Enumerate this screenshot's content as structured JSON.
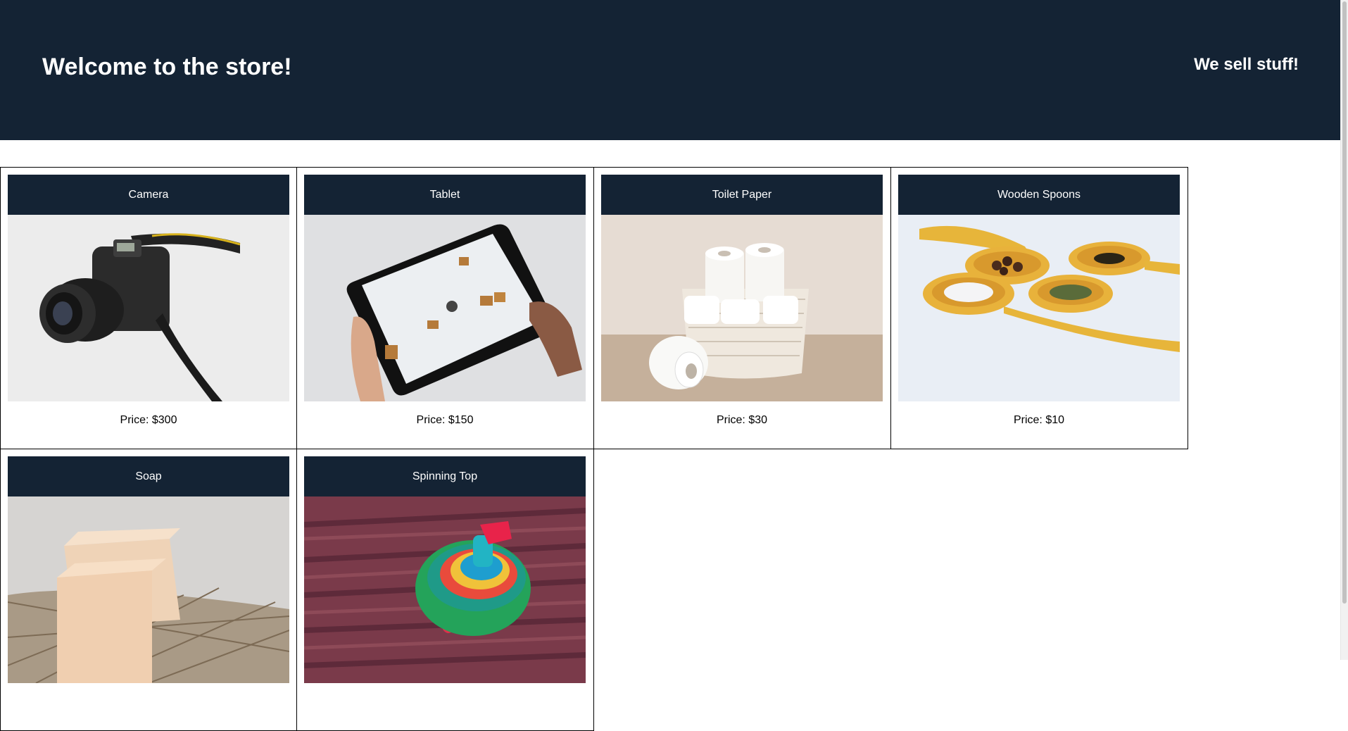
{
  "header": {
    "title": "Welcome to the store!",
    "tagline": "We sell stuff!"
  },
  "products": [
    {
      "name": "Camera",
      "price": "Price: $300"
    },
    {
      "name": "Tablet",
      "price": "Price: $150"
    },
    {
      "name": "Toilet Paper",
      "price": "Price: $30"
    },
    {
      "name": "Wooden Spoons",
      "price": "Price: $10"
    },
    {
      "name": "Soap",
      "price": ""
    },
    {
      "name": "Spinning Top",
      "price": ""
    }
  ],
  "colors": {
    "header_bg": "#142334",
    "header_text": "#ffffff"
  }
}
